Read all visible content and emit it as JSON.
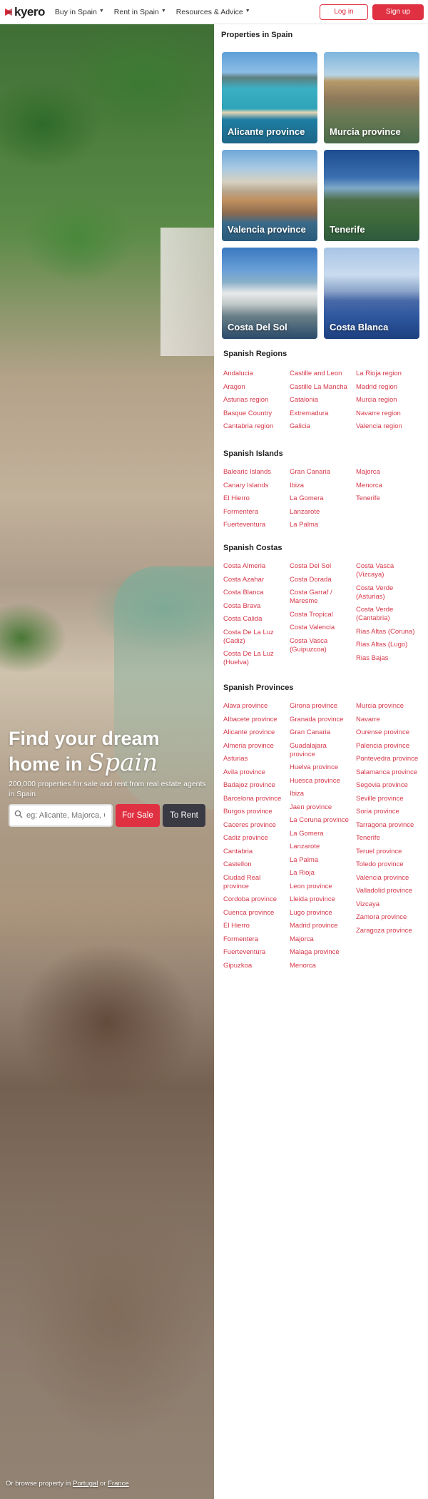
{
  "header": {
    "logo_text": "kyero",
    "nav": [
      {
        "label": "Buy in Spain"
      },
      {
        "label": "Rent in Spain"
      },
      {
        "label": "Resources & Advice"
      }
    ],
    "login_label": "Log in",
    "signup_label": "Sign up"
  },
  "hero": {
    "title_line1": "Find your dream",
    "title_line2_prefix": "home in",
    "title_script": "Spain",
    "subtitle": "200,000 properties for sale and rent from real estate agents in Spain",
    "search_placeholder": "eg: Alicante, Majorca, Costa Blanca",
    "for_sale_label": "For Sale",
    "to_rent_label": "To Rent",
    "browse_prefix": "Or browse property in",
    "browse_link1": "Portugal",
    "browse_or": "or",
    "browse_link2": "France"
  },
  "properties": {
    "title": "Properties in Spain",
    "tiles": [
      {
        "label": "Alicante province"
      },
      {
        "label": "Murcia province"
      },
      {
        "label": "Valencia province"
      },
      {
        "label": "Tenerife"
      },
      {
        "label": "Costa Del Sol"
      },
      {
        "label": "Costa Blanca"
      }
    ]
  },
  "regions": {
    "title": "Spanish Regions",
    "col1": [
      "Andalucia",
      "Aragon",
      "Asturias region",
      "Basque Country",
      "Cantabria region"
    ],
    "col2": [
      "Castille and Leon",
      "Castille La Mancha",
      "Catalonia",
      "Extremadura",
      "Galicia"
    ],
    "col3": [
      "La Rioja region",
      "Madrid region",
      "Murcia region",
      "Navarre region",
      "Valencia region"
    ]
  },
  "islands": {
    "title": "Spanish Islands",
    "col1": [
      "Balearic Islands",
      "Canary Islands",
      "El Hierro",
      "Formentera",
      "Fuerteventura"
    ],
    "col2": [
      "Gran Canaria",
      "Ibiza",
      "La Gomera",
      "Lanzarote",
      "La Palma"
    ],
    "col3": [
      "Majorca",
      "Menorca",
      "Tenerife"
    ]
  },
  "costas": {
    "title": "Spanish Costas",
    "col1": [
      "Costa Almeria",
      "Costa Azahar",
      "Costa Blanca",
      "Costa Brava",
      "Costa Calida",
      "Costa De La Luz (Cadiz)",
      "Costa De La Luz (Huelva)"
    ],
    "col2": [
      "Costa Del Sol",
      "Costa Dorada",
      "Costa Garraf / Maresme",
      "Costa Tropical",
      "Costa Valencia",
      "Costa Vasca (Guipuzcoa)"
    ],
    "col3": [
      "Costa Vasca (Vizcaya)",
      "Costa Verde (Asturias)",
      "Costa Verde (Cantabria)",
      "Rias Altas (Coruna)",
      "Rias Altas (Lugo)",
      "Rias Bajas"
    ]
  },
  "provinces": {
    "title": "Spanish Provinces",
    "col1": [
      "Alava province",
      "Albacete province",
      "Alicante province",
      "Almeria province",
      "Asturias",
      "Avila province",
      "Badajoz province",
      "Barcelona province",
      "Burgos province",
      "Caceres province",
      "Cadiz province",
      "Cantabria",
      "Castellon",
      "Ciudad Real province",
      "Cordoba province",
      "Cuenca province",
      "El Hierro",
      "Formentera",
      "Fuerteventura",
      "Gipuzkoa"
    ],
    "col2": [
      "Girona province",
      "Granada province",
      "Gran Canaria",
      "Guadalajara province",
      "Huelva province",
      "Huesca province",
      "Ibiza",
      "Jaen province",
      "La Coruna province",
      "La Gomera",
      "Lanzarote",
      "La Palma",
      "La Rioja",
      "Leon province",
      "Lleida province",
      "Lugo province",
      "Madrid province",
      "Majorca",
      "Malaga province",
      "Menorca"
    ],
    "col3": [
      "Murcia province",
      "Navarre",
      "Ourense province",
      "Palencia province",
      "Pontevedra province",
      "Salamanca province",
      "Segovia province",
      "Seville province",
      "Soria province",
      "Tarragona province",
      "Tenerife",
      "Teruel province",
      "Toledo province",
      "Valencia province",
      "Valladolid province",
      "Vizcaya",
      "Zamora province",
      "Zaragoza province"
    ]
  },
  "colors": {
    "brand_red": "#e03142",
    "link_red": "#d6384a",
    "dark_button": "#3a3a44"
  }
}
